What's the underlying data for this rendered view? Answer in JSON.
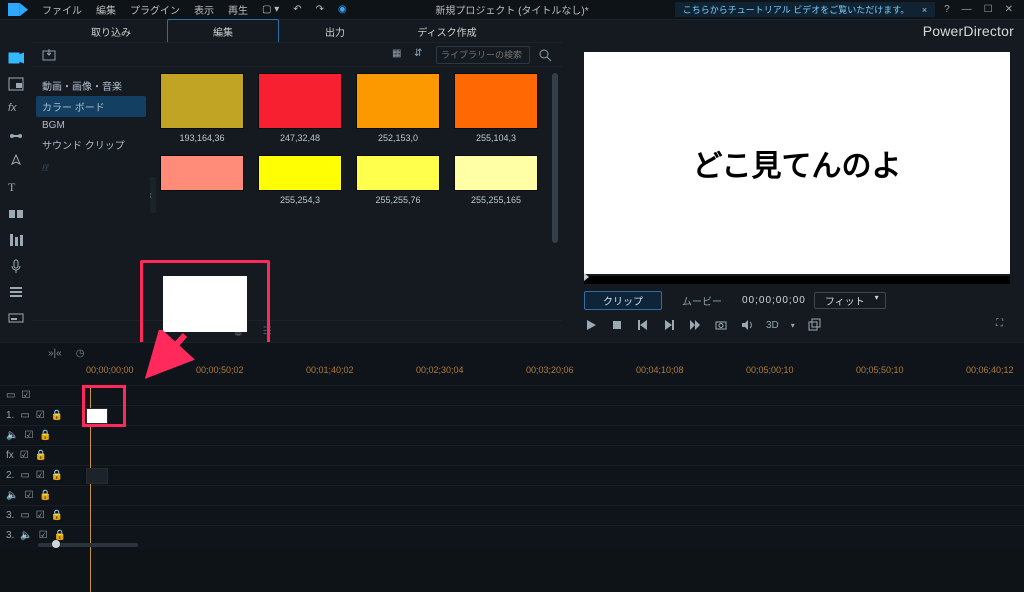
{
  "app": {
    "brand": "PowerDirector",
    "title": "新規プロジェクト (タイトルなし)*"
  },
  "menu": {
    "file": "ファイル",
    "edit": "編集",
    "plugin": "プラグイン",
    "view": "表示",
    "play": "再生"
  },
  "tip": {
    "text": "こちらからチュートリアル ビデオをご覧いただけます。",
    "close": "×",
    "help": "?",
    "min": "—",
    "max": "☐",
    "x": "✕"
  },
  "tabs": {
    "import": "取り込み",
    "edit": "編集",
    "output": "出力",
    "disc": "ディスク作成"
  },
  "library": {
    "search_placeholder": "ライブラリーの検索"
  },
  "cats": {
    "c1": "動画・画像・音楽",
    "c2": "カラー ボード",
    "c3": "BGM",
    "c4": "サウンド クリップ"
  },
  "swatches": {
    "r1": [
      {
        "rgb": "193,164,36",
        "hex": "#c1a424"
      },
      {
        "rgb": "247,32,48",
        "hex": "#f72030"
      },
      {
        "rgb": "252,153,0",
        "hex": "#fc9900"
      },
      {
        "rgb": "255,104,3",
        "hex": "#ff6803"
      }
    ],
    "r2": [
      {
        "rgb": "",
        "hex": "#ff8b78"
      },
      {
        "rgb": "255,254,3",
        "hex": "#fffe03"
      },
      {
        "rgb": "255,255,76",
        "hex": "#ffff4c"
      },
      {
        "rgb": "255,255,165",
        "hex": "#ffffa5"
      }
    ],
    "selected": {
      "rgb": "255,255,255",
      "hex": "#ffffff"
    }
  },
  "preview": {
    "text": "どこ見てんのよ",
    "clip_tab": "クリップ",
    "movie_tab": "ムービー",
    "timecode": "00;00;00;00",
    "fit": "フィット",
    "threeD": "3D"
  },
  "ruler": {
    "t0": "00;00;00;00",
    "t1": "00;00;50;02",
    "t2": "00;01;40;02",
    "t3": "00;02;30;04",
    "t4": "00;03;20;06",
    "t5": "00;04;10;08",
    "t6": "00;05;00;10",
    "t7": "00;05;50;10",
    "t8": "00;06;40;12"
  },
  "trk": {
    "l1": "1.",
    "l2": "2.",
    "l3": "3.",
    "fx": "fx"
  }
}
